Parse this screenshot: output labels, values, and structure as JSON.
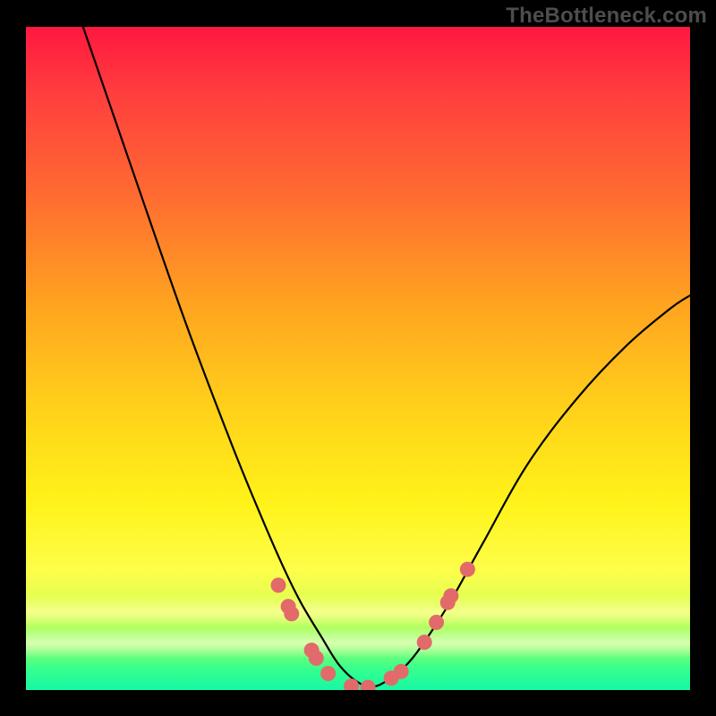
{
  "watermark": "TheBottleneck.com",
  "chart_data": {
    "type": "line",
    "title": "",
    "xlabel": "",
    "ylabel": "",
    "note": "Bottleneck-style curve plotted over a vertical red→green gradient. No visible axis tick labels, so x/y are in plot-fraction coordinates (0–1, origin at top-left). Lower y = higher on image.",
    "xlim": [
      0,
      1
    ],
    "ylim": [
      0,
      1
    ],
    "series": [
      {
        "name": "curve",
        "x": [
          0.086,
          0.16,
          0.24,
          0.31,
          0.355,
          0.39,
          0.415,
          0.445,
          0.47,
          0.495,
          0.52,
          0.545,
          0.575,
          0.605,
          0.64,
          0.69,
          0.755,
          0.83,
          0.905,
          0.97,
          1.0
        ],
        "y": [
          0.0,
          0.215,
          0.445,
          0.63,
          0.74,
          0.82,
          0.87,
          0.92,
          0.96,
          0.985,
          0.995,
          0.985,
          0.96,
          0.92,
          0.865,
          0.775,
          0.66,
          0.56,
          0.48,
          0.425,
          0.405
        ]
      }
    ],
    "markers": {
      "name": "dots",
      "x": [
        0.38,
        0.395,
        0.4,
        0.43,
        0.437,
        0.455,
        0.49,
        0.515,
        0.55,
        0.565,
        0.6,
        0.618,
        0.635,
        0.64,
        0.665
      ],
      "y": [
        0.842,
        0.874,
        0.885,
        0.94,
        0.952,
        0.975,
        0.994,
        0.996,
        0.982,
        0.972,
        0.928,
        0.898,
        0.868,
        0.858,
        0.818
      ]
    },
    "gradient_stops": [
      {
        "pos": 0.0,
        "color": "#ff173f"
      },
      {
        "pos": 0.25,
        "color": "#ff6a32"
      },
      {
        "pos": 0.58,
        "color": "#ffd21a"
      },
      {
        "pos": 0.82,
        "color": "#fdfe4a"
      },
      {
        "pos": 1.0,
        "color": "#17f7a4"
      }
    ]
  }
}
